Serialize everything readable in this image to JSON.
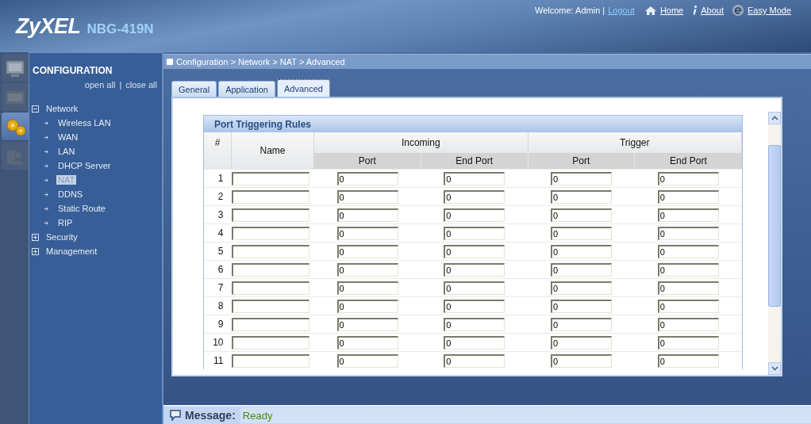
{
  "header": {
    "brand": "ZyXEL",
    "model": "NBG-419N",
    "welcome": "Welcome: Admin |",
    "links": [
      {
        "kind": "logout",
        "label": "Logout"
      },
      {
        "kind": "home",
        "label": "Home"
      },
      {
        "kind": "about",
        "label": "About"
      },
      {
        "kind": "easy",
        "label": "Easy Mode"
      }
    ]
  },
  "icon_tabs": [
    {
      "kind": "monitor",
      "selected": false
    },
    {
      "kind": "screen",
      "selected": false
    },
    {
      "kind": "gears",
      "selected": true
    },
    {
      "kind": "user",
      "selected": false
    }
  ],
  "sidebar": {
    "title": "CONFIGURATION",
    "open_all": "open all",
    "separator": "|",
    "close_all": "close all",
    "items": [
      {
        "label": "Network",
        "expanded": true,
        "children": [
          {
            "label": "Wireless LAN",
            "selected": false
          },
          {
            "label": "WAN",
            "selected": false
          },
          {
            "label": "LAN",
            "selected": false
          },
          {
            "label": "DHCP Server",
            "selected": false
          },
          {
            "label": "NAT",
            "selected": true
          },
          {
            "label": "DDNS",
            "selected": false
          },
          {
            "label": "Static Route",
            "selected": false
          },
          {
            "label": "RIP",
            "selected": false
          }
        ]
      },
      {
        "label": "Security",
        "expanded": false
      },
      {
        "label": "Management",
        "expanded": false
      }
    ]
  },
  "breadcrumb": "Configuration > Network > NAT > Advanced",
  "tabs": [
    {
      "label": "General",
      "selected": false
    },
    {
      "label": "Application",
      "selected": false
    },
    {
      "label": "Advanced",
      "selected": true
    }
  ],
  "table": {
    "title": "Port Triggering Rules",
    "columns": {
      "number": "#",
      "name": "Name",
      "incoming": "Incoming",
      "trigger": "Trigger",
      "sub": [
        "Port",
        "End Port",
        "Port",
        "End Port"
      ]
    },
    "rows": [
      {
        "number": "1",
        "ports": [
          "0",
          "0",
          "0",
          "0"
        ]
      },
      {
        "number": "2",
        "ports": [
          "0",
          "0",
          "0",
          "0"
        ]
      },
      {
        "number": "3",
        "ports": [
          "0",
          "0",
          "0",
          "0"
        ]
      },
      {
        "number": "4",
        "ports": [
          "0",
          "0",
          "0",
          "0"
        ]
      },
      {
        "number": "5",
        "ports": [
          "0",
          "0",
          "0",
          "0"
        ]
      },
      {
        "number": "6",
        "ports": [
          "0",
          "0",
          "0",
          "0"
        ]
      },
      {
        "number": "7",
        "ports": [
          "0",
          "0",
          "0",
          "0"
        ]
      },
      {
        "number": "8",
        "ports": [
          "0",
          "0",
          "0",
          "0"
        ]
      },
      {
        "number": "9",
        "ports": [
          "0",
          "0",
          "0",
          "0"
        ]
      },
      {
        "number": "10",
        "ports": [
          "0",
          "0",
          "0",
          "0"
        ]
      },
      {
        "number": "11",
        "ports": [
          "0",
          "0",
          "0",
          "0"
        ]
      }
    ]
  },
  "message_bar": {
    "label": "Message:",
    "status": "Ready"
  }
}
